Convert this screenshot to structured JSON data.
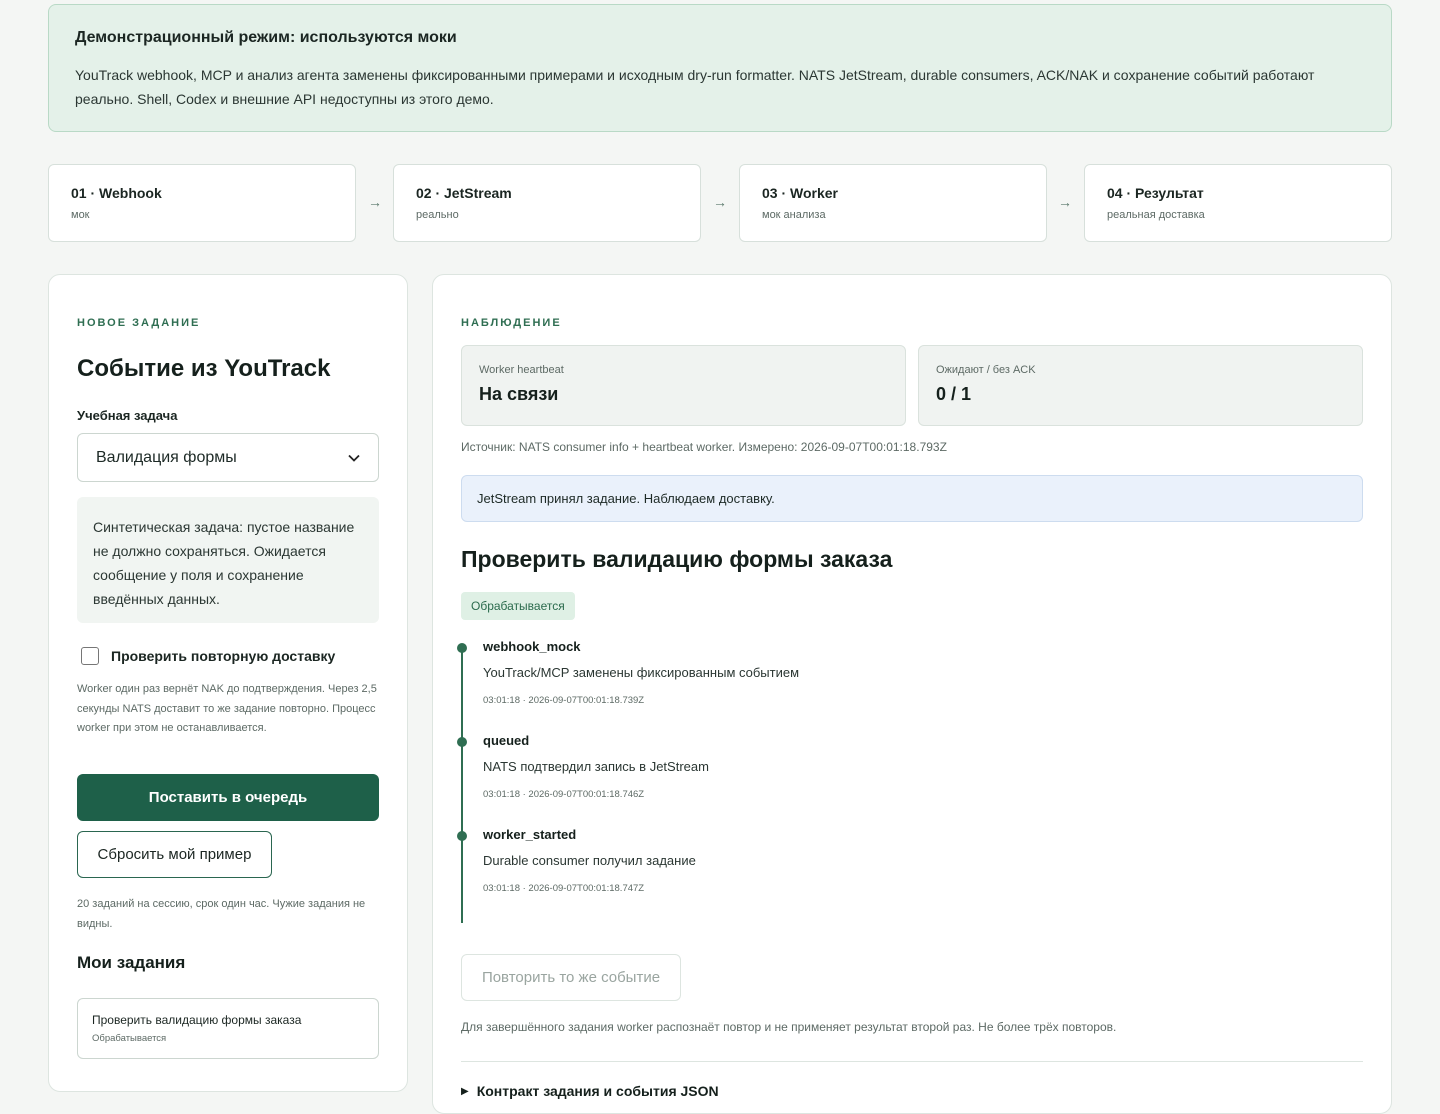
{
  "banner": {
    "title": "Демонстрационный режим: используются моки",
    "text": "YouTrack webhook, MCP и анализ агента заменены фиксированными примерами и исходным dry-run formatter. NATS JetStream, durable consumers, ACK/NAK и сохранение событий работают реально. Shell, Codex и внешние API недоступны из этого демо."
  },
  "pipeline": {
    "steps": [
      {
        "title": "01 · Webhook",
        "sub": "мок"
      },
      {
        "title": "02 · JetStream",
        "sub": "реально"
      },
      {
        "title": "03 · Worker",
        "sub": "мок анализа"
      },
      {
        "title": "04 · Результат",
        "sub": "реальная доставка"
      }
    ],
    "arrow": "→"
  },
  "form": {
    "eyebrow": "НОВОЕ ЗАДАНИЕ",
    "title": "Событие из YouTrack",
    "field_label": "Учебная задача",
    "selected_task": "Валидация формы",
    "task_description": "Синтетическая задача: пустое название не должно сохраняться. Ожидается сообщение у поля и сохранение введённых данных.",
    "redelivery_label": "Проверить повторную доставку",
    "redelivery_checked": false,
    "redelivery_hint": "Worker один раз вернёт NAK до подтверждения. Через 2,5 секунды NATS доставит то же задание повторно. Процесс worker при этом не останавливается.",
    "submit_label": "Поставить в очередь",
    "reset_label": "Сбросить мой пример",
    "limit_hint": "20 заданий на сессию, срок один час. Чужие задания не видны.",
    "my_tasks_title": "Мои задания",
    "my_tasks": [
      {
        "title": "Проверить валидацию формы заказа",
        "status": "Обрабатывается"
      }
    ]
  },
  "observation": {
    "eyebrow": "НАБЛЮДЕНИЕ",
    "heartbeat_label": "Worker heartbeat",
    "heartbeat_value": "На связи",
    "pending_label": "Ожидают / без ACK",
    "pending_value": "0 / 1",
    "source": "Источник: NATS consumer info + heartbeat worker. Измерено: 2026-09-07T00:01:18.793Z",
    "info": "JetStream принял задание. Наблюдаем доставку.",
    "task_title": "Проверить валидацию формы заказа",
    "status_badge": "Обрабатывается",
    "events": [
      {
        "name": "webhook_mock",
        "message": "YouTrack/MCP заменены фиксированным событием",
        "time": "03:01:18 · 2026-09-07T00:01:18.739Z"
      },
      {
        "name": "queued",
        "message": "NATS подтвердил запись в JetStream",
        "time": "03:01:18 · 2026-09-07T00:01:18.746Z"
      },
      {
        "name": "worker_started",
        "message": "Durable consumer получил задание",
        "time": "03:01:18 · 2026-09-07T00:01:18.747Z"
      }
    ],
    "replay_label": "Повторить то же событие",
    "replay_note": "Для завершённого задания worker распознаёт повтор и не применяет результат второй раз. Не более трёх повторов.",
    "details_label": "Контракт задания и события JSON"
  }
}
